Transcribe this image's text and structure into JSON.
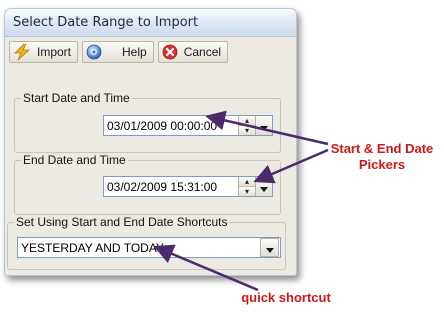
{
  "window": {
    "title": "Select Date Range to Import"
  },
  "toolbar": {
    "import_label": "Import",
    "help_label": "Help",
    "cancel_label": "Cancel",
    "icons": {
      "import": "lightning-icon",
      "help": "help-icon",
      "cancel": "cancel-x-icon"
    }
  },
  "start": {
    "group_label": "Start Date and Time",
    "value": "03/01/2009 00:00:00"
  },
  "end": {
    "group_label": "End Date and Time",
    "value": "03/02/2009 15:31:00"
  },
  "shortcut": {
    "group_label": "Set Using Start and End Date Shortcuts",
    "selected": "YESTERDAY AND TODAY"
  },
  "annotations": {
    "pickers_line1": "Start & End Date",
    "pickers_line2": "Pickers",
    "shortcut": "quick shortcut"
  },
  "colors": {
    "annotation_text": "#d01818",
    "annotation_arrow": "#4b2a6e"
  }
}
